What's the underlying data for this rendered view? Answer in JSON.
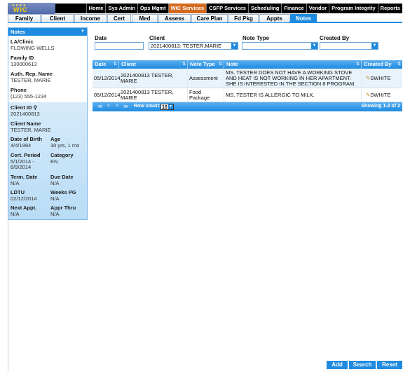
{
  "top_nav": {
    "logo": "WIC",
    "items": [
      "Home",
      "Sys Admin",
      "Ops Mgmt",
      "WIC Services",
      "CSFP Services",
      "Scheduling",
      "Finance",
      "Vendor",
      "Program Integrity",
      "Reports"
    ],
    "active": "WIC Services"
  },
  "tabs": {
    "items": [
      "Family",
      "Client",
      "Income",
      "Cert",
      "Med",
      "Assess",
      "Care Plan",
      "Fd Pkg",
      "Appts",
      "Notes"
    ],
    "active": "Notes"
  },
  "side_panel": {
    "header": "Notes",
    "la_clinic_label": "LA/Clinic",
    "la_clinic_value": "FLOWING WELLS",
    "family_id_label": "Family ID",
    "family_id_value": "130000613",
    "auth_rep_label": "Auth. Rep. Name",
    "auth_rep_value": "TESTER, MARIE",
    "phone_label": "Phone",
    "phone_value": "(123) 555-1234",
    "client_id_label": "Client ID",
    "client_id_value": "2021400813",
    "client_name_label": "Client Name",
    "client_name_value": "TESTER, MARIE",
    "dob_label": "Date of Birth",
    "dob_value": "4/4/1984",
    "age_label": "Age",
    "age_value": "30 yrs, 1 mo",
    "cert_period_label": "Cert. Period",
    "cert_period_value1": "5/1/2014 -",
    "cert_period_value2": "8/9/2014",
    "category_label": "Category",
    "category_value": "EN",
    "term_date_label": "Term. Date",
    "term_date_value": "N/A",
    "due_date_label": "Due Date",
    "due_date_value": "N/A",
    "ldtu_label": "LDTU",
    "ldtu_value": "02/12/2014",
    "weeks_pg_label": "Weeks PG",
    "weeks_pg_value": "N/A",
    "next_appt_label": "Next Appt.",
    "next_appt_value": "N/A",
    "appr_thru_label": "Appr Thru",
    "appr_thru_value": "N/A"
  },
  "filters": {
    "date_label": "Date",
    "date_value": "",
    "client_label": "Client",
    "client_value": "2021400813: TESTER,MARIE",
    "note_type_label": "Note Type",
    "note_type_value": "",
    "created_by_label": "Created By",
    "created_by_value": ""
  },
  "grid": {
    "columns": [
      "Date",
      "Client",
      "Note Type",
      "Note",
      "Created By"
    ],
    "rows": [
      {
        "date": "05/12/2014",
        "client1": "2021400813 TESTER,",
        "client2": "MARIE",
        "note_type": "Assessment",
        "note1": "MS. TESTER DOES NOT HAVE A WORKING STOVE",
        "note2": "AND HEAT IS NOT WORKING IN HER APARTMENT.",
        "note3": "SHE IS INTERESTED IN THE SECTION 8 PROGRAM.",
        "created_by": "SWHITE"
      },
      {
        "date": "05/12/2014",
        "client1": "2021400813 TESTER,",
        "client2": "MARIE",
        "note_type": "Food Package",
        "note1": "MS. TESTER IS ALLERGIC TO MILK.",
        "note2": "",
        "note3": "",
        "created_by": "SWHITE"
      }
    ],
    "row_count_label": "Row count:",
    "row_count_value": "10",
    "showing": "Showing 1-2 of 2"
  },
  "buttons": {
    "add": "Add",
    "search": "Search",
    "reset": "Reset"
  },
  "colors": {
    "accent": "#1f8be0",
    "active_nav": "#d2691e",
    "panel_bg": "#c8e3f8"
  },
  "icons": [
    "person-icon",
    "edit-icon",
    "dropdown-arrow-icon",
    "sort-icon"
  ]
}
